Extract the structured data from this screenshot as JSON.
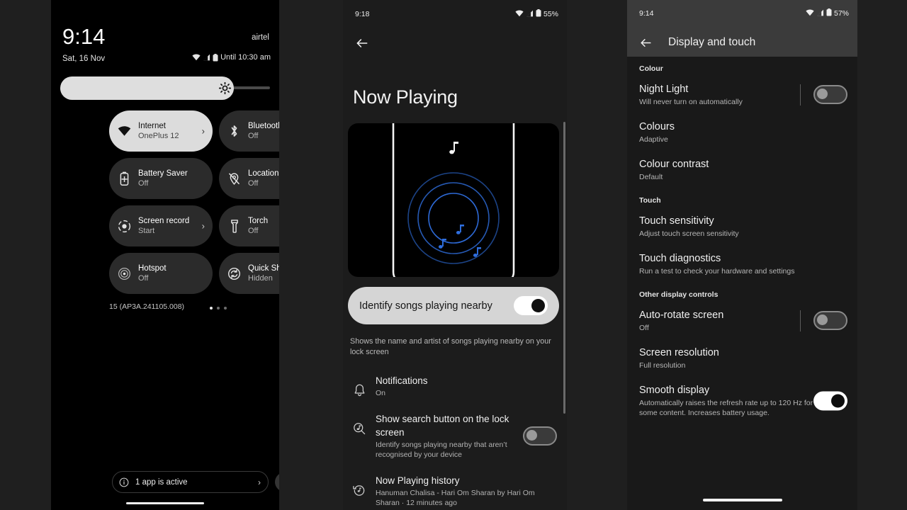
{
  "quick_settings": {
    "time": "9:14",
    "date": "Sat, 16 Nov",
    "carrier": "airtel",
    "status_text": "Until 10:30 am",
    "brightness_percent": 83,
    "tiles": [
      {
        "title": "Internet",
        "sub": "OnePlus 12",
        "icon": "wifi-icon",
        "active": true,
        "chevron": true
      },
      {
        "title": "Bluetooth",
        "sub": "Off",
        "icon": "bluetooth-icon",
        "active": false,
        "chevron": true
      },
      {
        "title": "Battery Saver",
        "sub": "Off",
        "icon": "battery-saver-icon",
        "active": false,
        "chevron": false
      },
      {
        "title": "Location",
        "sub": "Off",
        "icon": "location-off-icon",
        "active": false,
        "chevron": false
      },
      {
        "title": "Screen record",
        "sub": "Start",
        "icon": "record-icon",
        "active": false,
        "chevron": true
      },
      {
        "title": "Torch",
        "sub": "Off",
        "icon": "torch-icon",
        "active": false,
        "chevron": false
      },
      {
        "title": "Hotspot",
        "sub": "Off",
        "icon": "hotspot-icon",
        "active": false,
        "chevron": false
      },
      {
        "title": "Quick Share",
        "sub": "Hidden",
        "icon": "quick-share-icon",
        "active": false,
        "chevron": true
      }
    ],
    "build_number": "15 (AP3A.241105.008)",
    "page_dots": 3,
    "page_active": 0,
    "edit_icon": "pencil-icon",
    "active_apps_label": "1 app is active",
    "settings_icon": "gear-icon",
    "power_icon": "power-icon"
  },
  "now_playing": {
    "time": "9:18",
    "battery": "55%",
    "back_icon": "back-arrow-icon",
    "title": "Now Playing",
    "hero_icon": "phone-listening-illustration",
    "toggle": {
      "label": "Identify songs playing nearby",
      "state": "on"
    },
    "description": "Shows the name and artist of songs playing nearby on your lock screen",
    "items": [
      {
        "icon": "bell-icon",
        "title": "Notifications",
        "sub": "On",
        "control": "none"
      },
      {
        "icon": "search-music-icon",
        "title": "Show search button on the lock screen",
        "sub": "Identify songs playing nearby that aren’t recognised by your device",
        "control": "switch-off"
      },
      {
        "icon": "history-music-icon",
        "title": "Now Playing history",
        "sub": "Hanuman Chalisa - Hari Om Sharan by Hari Om Sharan · 12 minutes ago",
        "control": "none"
      }
    ]
  },
  "display_touch": {
    "time": "9:14",
    "battery": "57%",
    "back_icon": "back-arrow-icon",
    "title": "Display and touch",
    "sections": [
      {
        "heading": "Colour",
        "rows": [
          {
            "title": "Night Light",
            "sub": "Will never turn on automatically",
            "control": "switch-off",
            "divider": true
          },
          {
            "title": "Colours",
            "sub": "Adaptive",
            "control": "none",
            "divider": false
          },
          {
            "title": "Colour contrast",
            "sub": "Default",
            "control": "none",
            "divider": false
          }
        ]
      },
      {
        "heading": "Touch",
        "rows": [
          {
            "title": "Touch sensitivity",
            "sub": "Adjust touch screen sensitivity",
            "control": "none",
            "divider": false
          },
          {
            "title": "Touch diagnostics",
            "sub": "Run a test to check your hardware and settings",
            "control": "none",
            "divider": false
          }
        ]
      },
      {
        "heading": "Other display controls",
        "rows": [
          {
            "title": "Auto-rotate screen",
            "sub": "Off",
            "control": "switch-off",
            "divider": true
          },
          {
            "title": "Screen resolution",
            "sub": "Full resolution",
            "control": "none",
            "divider": false
          },
          {
            "title": "Smooth display",
            "sub": "Automatically raises the refresh rate up to 120 Hz for some content. Increases battery usage.",
            "control": "switch-on",
            "divider": false
          }
        ]
      }
    ]
  },
  "colors": {
    "accent_blue": "#2f6fe0",
    "panel_black": "#000000",
    "panel_dark": "#1c1c1c",
    "tile_grey": "#2b2b2b",
    "tile_active": "#dcdcdc"
  }
}
